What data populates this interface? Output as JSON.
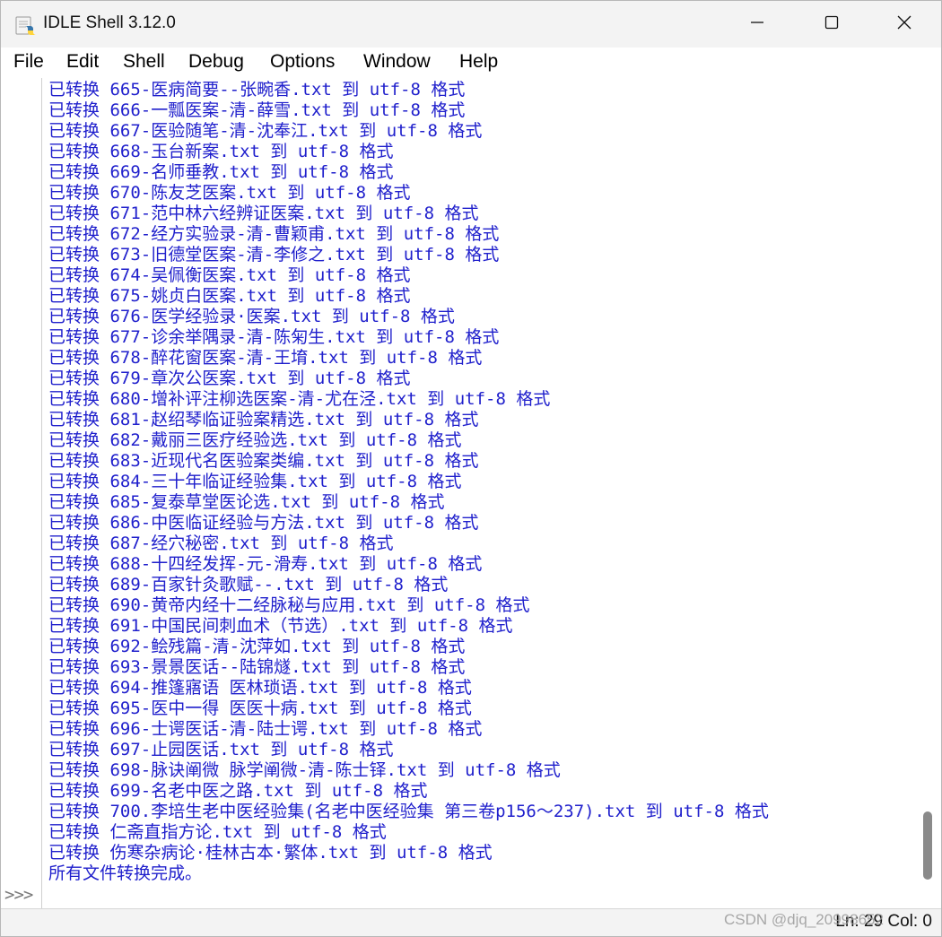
{
  "window": {
    "title": "IDLE Shell 3.12.0"
  },
  "icons": {
    "app": "python-app-icon",
    "minimize": "minimize-icon",
    "maximize": "maximize-icon",
    "close": "close-icon"
  },
  "colors": {
    "output_text": "#1f1fcc",
    "prompt": "#7a7a7a",
    "background": "#ffffff"
  },
  "menu": [
    "File",
    "Edit",
    "Shell",
    "Debug",
    "Options",
    "Window",
    "Help"
  ],
  "output_lines": [
    "已转换 665-医病简要--张畹香.txt 到 utf-8 格式",
    "已转换 666-一瓢医案-清-薛雪.txt 到 utf-8 格式",
    "已转换 667-医验随笔-清-沈奉江.txt 到 utf-8 格式",
    "已转换 668-玉台新案.txt 到 utf-8 格式",
    "已转换 669-名师垂教.txt 到 utf-8 格式",
    "已转换 670-陈友芝医案.txt 到 utf-8 格式",
    "已转换 671-范中林六经辨证医案.txt 到 utf-8 格式",
    "已转换 672-经方实验录-清-曹颖甫.txt 到 utf-8 格式",
    "已转换 673-旧德堂医案-清-李修之.txt 到 utf-8 格式",
    "已转换 674-吴佩衡医案.txt 到 utf-8 格式",
    "已转换 675-姚贞白医案.txt 到 utf-8 格式",
    "已转换 676-医学经验录·医案.txt 到 utf-8 格式",
    "已转换 677-诊余举隅录-清-陈匊生.txt 到 utf-8 格式",
    "已转换 678-醉花窗医案-清-王堉.txt 到 utf-8 格式",
    "已转换 679-章次公医案.txt 到 utf-8 格式",
    "已转换 680-增补评注柳选医案-清-尤在泾.txt 到 utf-8 格式",
    "已转换 681-赵绍琴临证验案精选.txt 到 utf-8 格式",
    "已转换 682-戴丽三医疗经验选.txt 到 utf-8 格式",
    "已转换 683-近现代名医验案类编.txt 到 utf-8 格式",
    "已转换 684-三十年临证经验集.txt 到 utf-8 格式",
    "已转换 685-复泰草堂医论选.txt 到 utf-8 格式",
    "已转换 686-中医临证经验与方法.txt 到 utf-8 格式",
    "已转换 687-经穴秘密.txt 到 utf-8 格式",
    "已转换 688-十四经发挥-元-滑寿.txt 到 utf-8 格式",
    "已转换 689-百家针灸歌赋--.txt 到 utf-8 格式",
    "已转换 690-黄帝内经十二经脉秘与应用.txt 到 utf-8 格式",
    "已转换 691-中国民间刺血术（节选）.txt 到 utf-8 格式",
    "已转换 692-鲙残篇-清-沈萍如.txt 到 utf-8 格式",
    "已转换 693-景景医话--陆锦燧.txt 到 utf-8 格式",
    "已转换 694-推篷寤语 医林琐语.txt 到 utf-8 格式",
    "已转换 695-医中一得 医医十病.txt 到 utf-8 格式",
    "已转换 696-士谔医话-清-陆士谔.txt 到 utf-8 格式",
    "已转换 697-止园医话.txt 到 utf-8 格式",
    "已转换 698-脉诀阐微 脉学阐微-清-陈士铎.txt 到 utf-8 格式",
    "已转换 699-名老中医之路.txt 到 utf-8 格式",
    "已转换 700.李培生老中医经验集(名老中医经验集 第三卷p156～237).txt 到 utf-8 格式",
    "已转换 仁斋直指方论.txt 到 utf-8 格式",
    "已转换 伤寒杂病论·桂林古本·繁体.txt 到 utf-8 格式",
    "所有文件转换完成。"
  ],
  "prompt": ">>>",
  "status": {
    "position": "Ln: 29 Col: 0"
  },
  "watermark": "CSDN @djq_20998652"
}
